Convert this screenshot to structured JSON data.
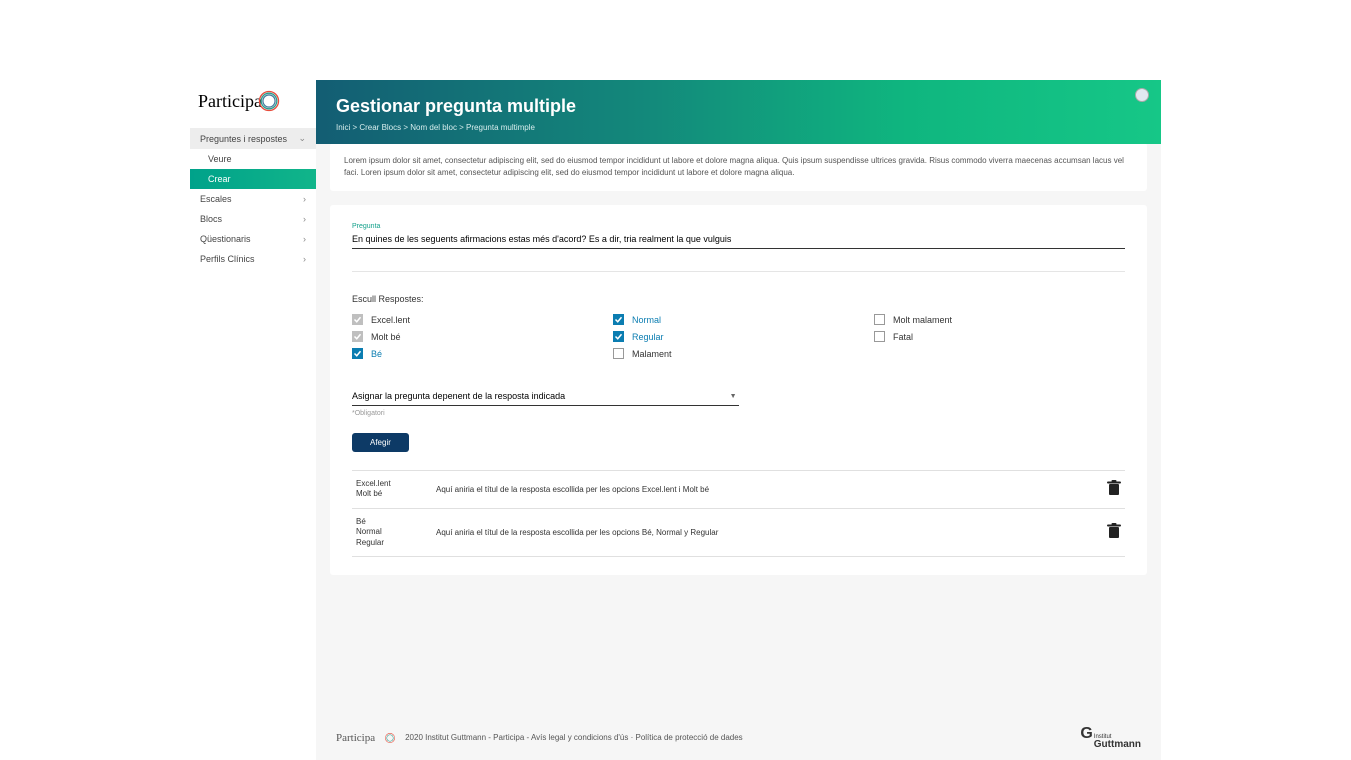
{
  "logo_text": "Participa",
  "nav": {
    "preguntes": {
      "label": "Preguntes i respostes",
      "veure": "Veure",
      "crear": "Crear"
    },
    "escales": "Escales",
    "blocs": "Blocs",
    "questionaris": "Qüestionaris",
    "perfils": "Perfils Clínics"
  },
  "header": {
    "title": "Gestionar pregunta multiple",
    "breadcrumb": "Inici > Crear Blocs > Nom del bloc > Pregunta multimple"
  },
  "intro": "Lorem ipsum dolor sit amet, consectetur adipiscing elit, sed do eiusmod tempor incididunt ut labore et dolore magna aliqua. Quis ipsum suspendisse ultrices gravida. Risus commodo viverra maecenas accumsan lacus vel faci. Loren ipsum dolor sit amet, consectetur adipiscing elit, sed do eiusmod tempor incididunt ut labore et dolore magna aliqua.",
  "form": {
    "question_label": "Pregunta",
    "question_value": "En quines de les seguents afirmacions estas més d'acord? Es a dir, tria realment la que vulguis",
    "answers_label": "Escull Respostes:",
    "answers": [
      {
        "label": "Excel.lent",
        "checked": true,
        "style": "disabled"
      },
      {
        "label": "Normal",
        "checked": true,
        "style": "blue"
      },
      {
        "label": "Molt malament",
        "checked": false,
        "style": "empty"
      },
      {
        "label": "Molt bé",
        "checked": true,
        "style": "disabled"
      },
      {
        "label": "Regular",
        "checked": true,
        "style": "blue"
      },
      {
        "label": "Fatal",
        "checked": false,
        "style": "empty"
      },
      {
        "label": "Bé",
        "checked": true,
        "style": "blue"
      },
      {
        "label": "Malament",
        "checked": false,
        "style": "empty"
      }
    ],
    "select_placeholder": "Asignar la pregunta depenent de la resposta indicada",
    "helper": "*Obligatori",
    "add_button": "Afegir",
    "deps": [
      {
        "answers": "Excel.lent\nMolt bé",
        "title": "Aquí aniria el títul de la resposta escollida per les opcions Excel.lent i Molt bé"
      },
      {
        "answers": "Bé\nNormal\nRegular",
        "title": "Aquí aniria el títul de la resposta escollida per les opcions Bé, Normal y Regular"
      }
    ]
  },
  "footer": {
    "text": "2020 Institut Guttmann - Participa - Avís legal y condicions d'ús  ·  Política de protecció de dades",
    "guttmann": "Guttmann",
    "guttmann_sub": "Institut"
  }
}
